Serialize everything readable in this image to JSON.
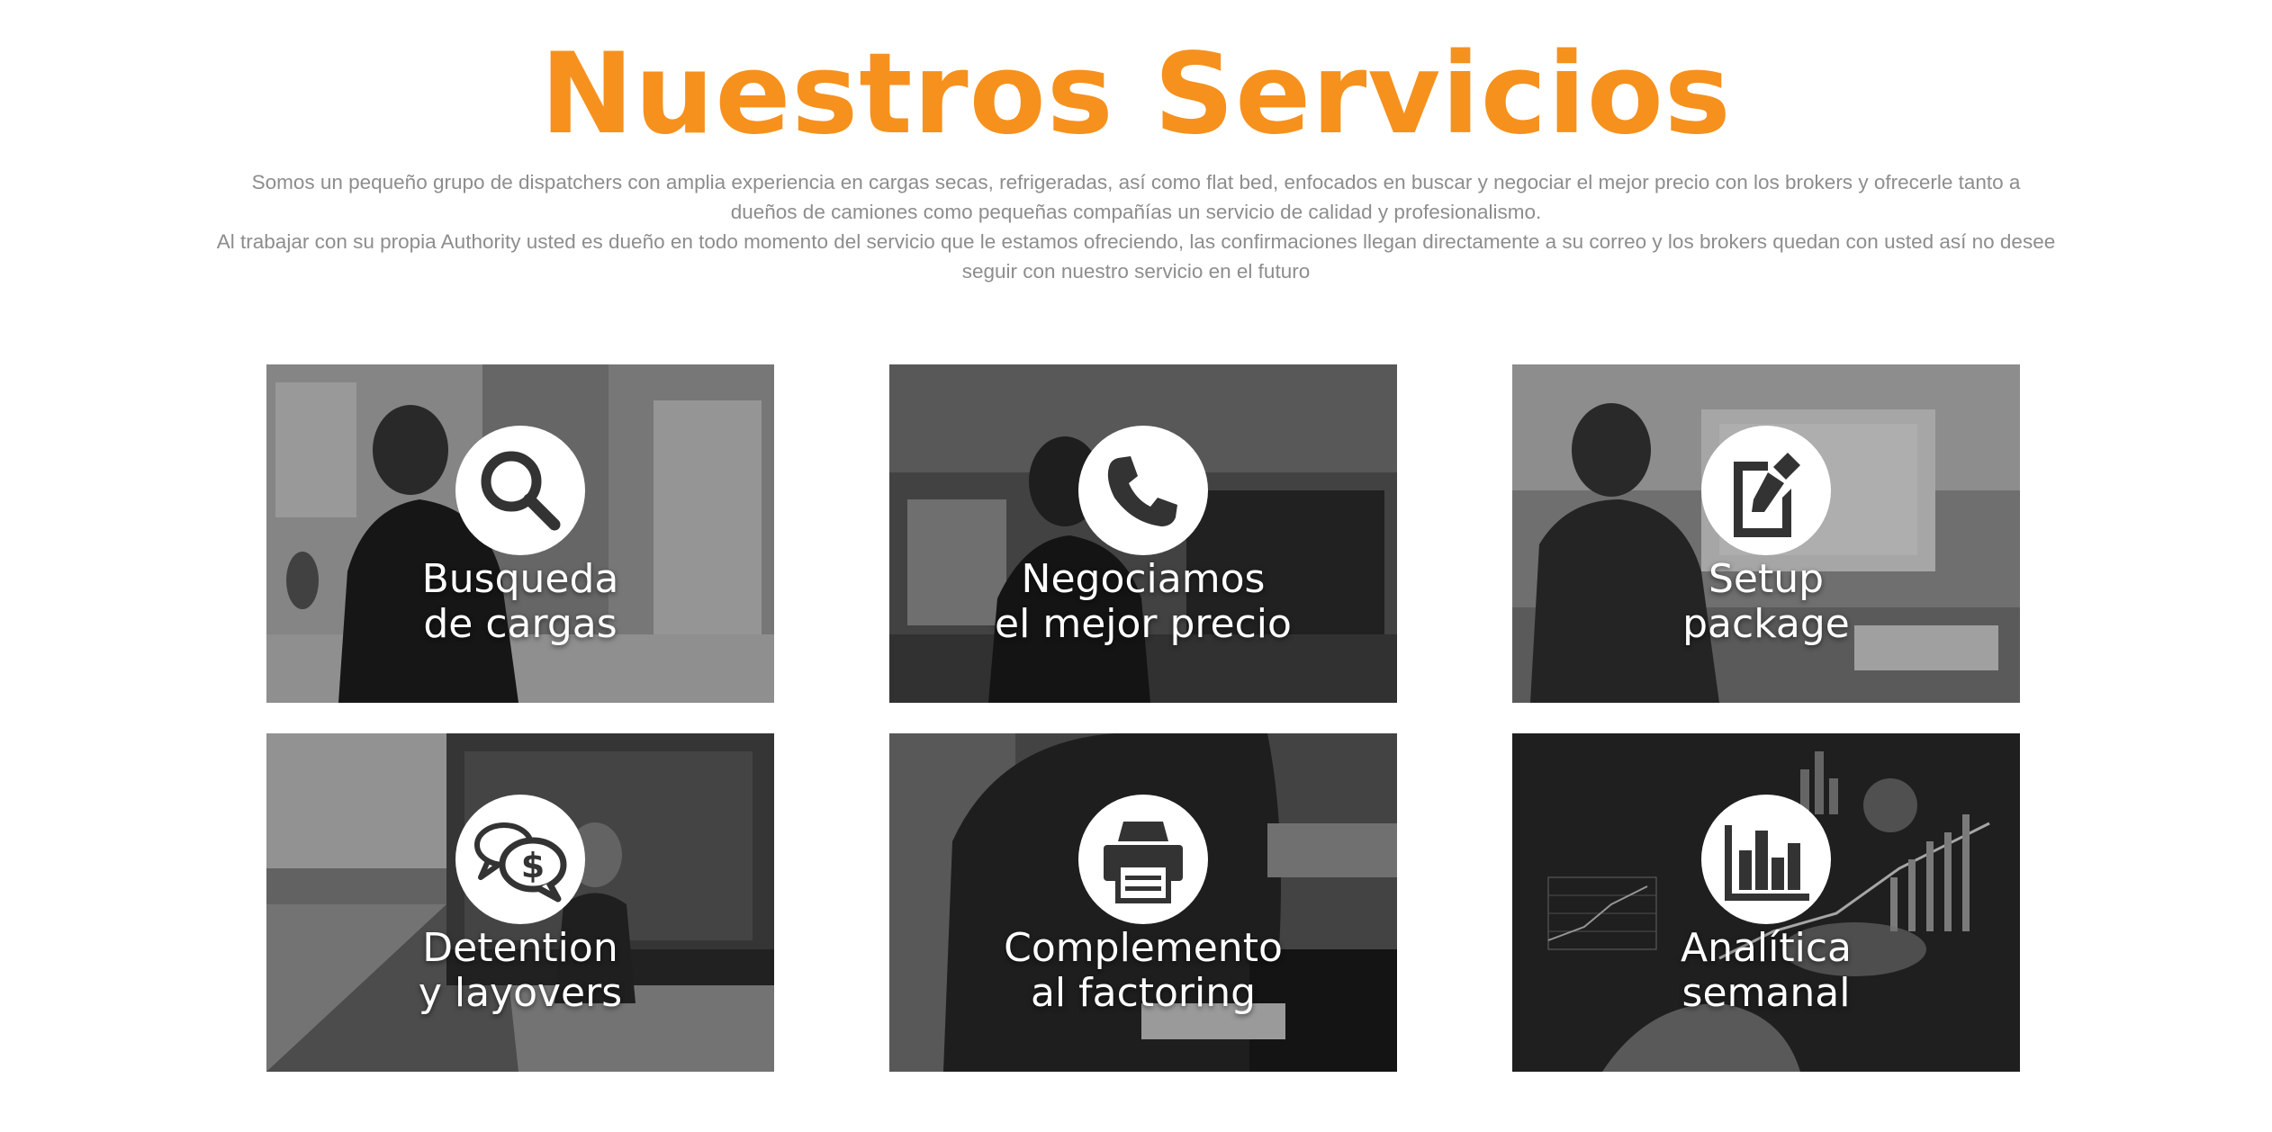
{
  "section": {
    "title": "Nuestros Servicios",
    "intro_line1": "Somos un pequeño grupo de dispatchers con amplia experiencia en cargas secas, refrigeradas, así como flat bed, enfocados en buscar y negociar el mejor precio con los brokers y ofrecerle tanto a dueños de camiones como pequeñas compañías un servicio de calidad y profesionalismo.",
    "intro_line2": "Al trabajar con su propia Authority usted es dueño en todo momento del servicio que le estamos ofreciendo, las confirmaciones llegan directamente a su correo y los brokers quedan con usted así no desee seguir con nuestro servicio en el futuro"
  },
  "colors": {
    "title": "#f6911e",
    "intro_text": "#8d8d8d",
    "card_label": "#ffffff",
    "icon_circle": "#ffffff",
    "icon_glyph": "#333333"
  },
  "services": [
    {
      "line1": "Busqueda",
      "line2": "de cargas",
      "icon": "search-icon"
    },
    {
      "line1": "Negociamos",
      "line2": "el mejor precio",
      "icon": "phone-icon"
    },
    {
      "line1": "Setup",
      "line2": "package",
      "icon": "document-edit-icon"
    },
    {
      "line1": "Detention",
      "line2": "y layovers",
      "icon": "chat-money-icon"
    },
    {
      "line1": "Complemento",
      "line2": "al factoring",
      "icon": "printer-icon"
    },
    {
      "line1": "Analítica",
      "line2": "semanal",
      "icon": "bar-chart-icon"
    }
  ]
}
